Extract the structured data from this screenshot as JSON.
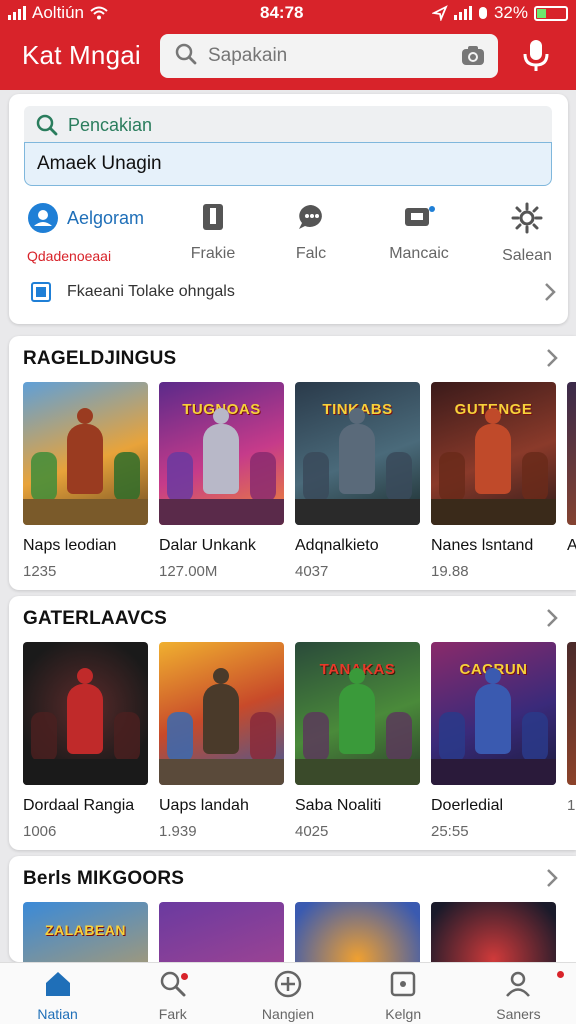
{
  "status": {
    "carrier": "Aoltiún",
    "time": "84:78",
    "battery": "32%",
    "battery_level": 0.32
  },
  "header": {
    "app_title": "Kat Mngai",
    "search_placeholder": "Sapakain"
  },
  "search_card": {
    "field_label": "Pencakian",
    "field_value": "Amaek Unagin",
    "quick_actions": [
      {
        "name": "Aelgoram",
        "label": "Qdadenoeaai"
      },
      {
        "label": "Frakie"
      },
      {
        "label": "Falc"
      },
      {
        "label": "Mancaic"
      },
      {
        "label": "Salean"
      }
    ],
    "consent_text": "Fkaeani Tolake ohngals"
  },
  "sections": [
    {
      "title": "RAGELDJINGUS",
      "games": [
        {
          "name": "Naps leodian",
          "count": "1235"
        },
        {
          "name": "Dalar Unkank",
          "count": "127.00M"
        },
        {
          "name": "Adqnalkieto",
          "count": "4037"
        },
        {
          "name": "Nanes lsntand",
          "count": "19.88"
        },
        {
          "name": "A",
          "count": ""
        }
      ],
      "banners": [
        "",
        "TUGNOAS",
        "TINKABS",
        "GUTENGE",
        ""
      ]
    },
    {
      "title": "GATERLAAVCS",
      "games": [
        {
          "name": "Dordaal Rangia",
          "count": "1006"
        },
        {
          "name": "Uaps landah",
          "count": "1.939"
        },
        {
          "name": "Saba Noaliti",
          "count": "4025"
        },
        {
          "name": "Doerledial",
          "count": "25:55"
        },
        {
          "name": "",
          "count": "1"
        }
      ],
      "banners": [
        "",
        "",
        "TANAKAS",
        "CACRUN",
        ""
      ]
    },
    {
      "title": "Berls MIKGOORS",
      "games": [
        {
          "name": "",
          "count": ""
        },
        {
          "name": "",
          "count": ""
        },
        {
          "name": "",
          "count": ""
        },
        {
          "name": "",
          "count": ""
        }
      ],
      "banners": [
        "ZALABEAN",
        "",
        "",
        ""
      ]
    }
  ],
  "bottom_nav": [
    {
      "label": "Natian",
      "icon": "home-icon",
      "active": true
    },
    {
      "label": "Fark",
      "icon": "search-icon"
    },
    {
      "label": "Nangien",
      "icon": "add-circle-icon"
    },
    {
      "label": "Kelgn",
      "icon": "square-icon"
    },
    {
      "label": "Saners",
      "icon": "profile-icon"
    }
  ],
  "colors": {
    "brand_red": "#d8232a",
    "accent_blue": "#1f6fb8",
    "text_green": "#2a7d5d"
  }
}
